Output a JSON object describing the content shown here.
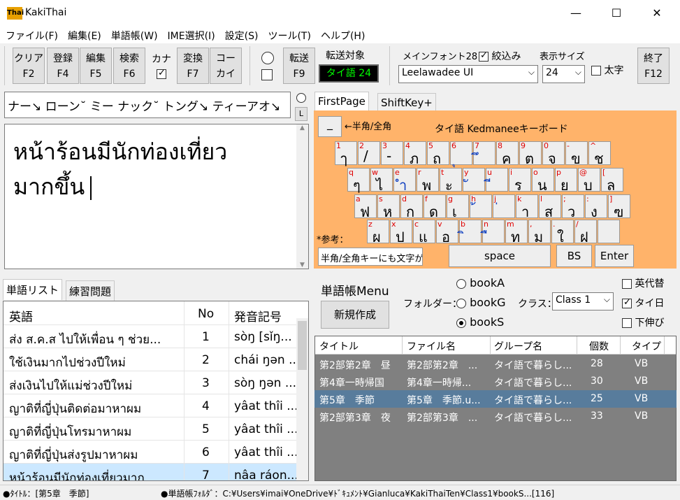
{
  "app": {
    "title": "KakiThai",
    "logo": "Thai"
  },
  "window": {
    "minimize": "—",
    "maximize": "☐",
    "close": "✕"
  },
  "menu": [
    "ファイル(F)",
    "編集(E)",
    "単語帳(W)",
    "IME選択(I)",
    "設定(S)",
    "ツール(T)",
    "ヘルプ(H)"
  ],
  "toolbar": {
    "clear": [
      "クリア",
      "F2"
    ],
    "register": [
      "登録",
      "F4"
    ],
    "edit": [
      "編集",
      "F5"
    ],
    "search": [
      "検索",
      "F6"
    ],
    "kana_label": "カナ",
    "convert": [
      "変換",
      "F7"
    ],
    "copy": [
      "コー",
      "カイ"
    ],
    "transfer": [
      "転送",
      "F9"
    ],
    "target_label": "転送対象",
    "target_value": "タイ語 24",
    "main_font_label": "メインフォント28",
    "filter_label": "絞込み",
    "font_value": "Leelawadee UI",
    "display_size_label": "表示サイズ",
    "size_value": "24",
    "bold_label": "太字",
    "exit": [
      "終了",
      "F12"
    ]
  },
  "reading": {
    "text": "ナー↘ ローン˘ ミー ナック˘ トング↘ ティーアオ↘",
    "side_button": "L"
  },
  "editor": {
    "line1": "หน้าร้อนมีนักท่องเที่ยว",
    "line2": "มากขึ้น"
  },
  "left_tabs": [
    "単語リスト",
    "練習問題"
  ],
  "word_table": {
    "headers": [
      "英語",
      "No",
      "発音記号"
    ],
    "rows": [
      [
        "ส่ง ส.ค.ส ไปให้เพื่อน ๆ ช่วย...",
        "1",
        "sòŋ [sǐŋ..."
      ],
      [
        "ใช้เงินมากไปช่วงปีใหม่",
        "2",
        "chái ŋən ..."
      ],
      [
        "ส่งเงินไปให้แม่ช่วงปีใหม่",
        "3",
        "sòŋ ŋən ..."
      ],
      [
        "ญาติที่ญี่ปุ่นติดต่อมาหาผม",
        "4",
        "yâat thîi ..."
      ],
      [
        "ญาติที่ญี่ปุ่นโทรมาหาผม",
        "5",
        "yâat thîi ..."
      ],
      [
        "ญาติที่ญี่ปุ่นส่งรูปมาหาผม",
        "6",
        "yâat thîi ..."
      ],
      [
        "หน้าร้อนมีนักท่องเที่ยวมาก",
        "7",
        "nâa ráon..."
      ]
    ]
  },
  "kb_tabs": [
    "FirstPage",
    "ShiftKey+"
  ],
  "keyboard": {
    "zen_key": "_",
    "zen_label": "←半角/全角",
    "title": "タイ語 Kedmaneeキーボード",
    "note": "*参考：",
    "note_box": "半角/全角キーにも文字が",
    "space": "space",
    "bs": "BS",
    "enter": "Enter",
    "rows": [
      [
        [
          "1",
          "ๅ"
        ],
        [
          "2",
          "/"
        ],
        [
          "3",
          "-"
        ],
        [
          "4",
          "ภ"
        ],
        [
          "5",
          "ถ"
        ],
        [
          "6",
          "ุ"
        ],
        [
          "7",
          "ึ"
        ],
        [
          "8",
          "ค"
        ],
        [
          "9",
          "ต"
        ],
        [
          "0",
          "จ"
        ],
        [
          "-",
          "ข"
        ],
        [
          "^",
          "ช"
        ]
      ],
      [
        [
          "q",
          "ๆ"
        ],
        [
          "w",
          "ไ"
        ],
        [
          "e",
          "ำ"
        ],
        [
          "r",
          "พ"
        ],
        [
          "t",
          "ะ"
        ],
        [
          "y",
          "ั"
        ],
        [
          "u",
          "ี"
        ],
        [
          "i",
          "ร"
        ],
        [
          "o",
          "น"
        ],
        [
          "p",
          "ย"
        ],
        [
          "@",
          "บ"
        ],
        [
          "[",
          "ล"
        ]
      ],
      [
        [
          "a",
          "ฟ"
        ],
        [
          "s",
          "ห"
        ],
        [
          "d",
          "ก"
        ],
        [
          "f",
          "ด"
        ],
        [
          "g",
          "เ"
        ],
        [
          "h",
          "้"
        ],
        [
          "j",
          "่"
        ],
        [
          "k",
          "า"
        ],
        [
          "l",
          "ส"
        ],
        [
          ";",
          "ว"
        ],
        [
          ":",
          "ง"
        ],
        [
          "]",
          "ฃ"
        ]
      ],
      [
        [
          "z",
          "ผ"
        ],
        [
          "x",
          "ป"
        ],
        [
          "c",
          "แ"
        ],
        [
          "v",
          "อ"
        ],
        [
          "b",
          "ิ"
        ],
        [
          "n",
          "ื"
        ],
        [
          "m",
          "ท"
        ],
        [
          ",",
          "ม"
        ],
        [
          ".",
          "ใ"
        ],
        [
          "/",
          "ฝ"
        ],
        [
          "",
          ""
        ]
      ]
    ]
  },
  "vocab": {
    "menu_label": "単語帳Menu",
    "new_button": "新規作成",
    "folder_label": "フォルダー：",
    "class_label": "クラス：",
    "folders": [
      "bookA",
      "bookG",
      "bookS"
    ],
    "class_value": "Class 1",
    "opt_eiyo": "英代替",
    "opt_thai": "タイ日",
    "opt_shita": "下伸び",
    "headers": [
      "タイトル",
      "ファイル名",
      "グループ名",
      "個数",
      "タイプ"
    ],
    "rows": [
      [
        "第2部第2章　昼",
        "第2部第2章　...",
        "タイ語で暮らし...",
        "28",
        "VB"
      ],
      [
        "第4章一時帰国",
        "第4章一時帰...",
        "タイ語で暮らし...",
        "30",
        "VB"
      ],
      [
        "第5章　季節",
        "第5章　季節.u...",
        "タイ語で暮らし...",
        "25",
        "VB"
      ],
      [
        "第2部第3章　夜",
        "第2部第3章　...",
        "タイ語で暮らし...",
        "33",
        "VB"
      ]
    ]
  },
  "status": {
    "left": "●ﾀｲﾄﾙ：[第5章　季節]",
    "right": "●単語帳ﾌｫﾙﾀﾞ：C:¥Users¥imai¥OneDrive¥ﾄﾞｷｭﾒﾝﾄ¥Gianluca¥KakiThaiTen¥Class1¥bookS...[116]"
  },
  "colors": {
    "keyboard_bg": "#ffb36a",
    "target_bg": "#000000",
    "target_fg": "#00ff00",
    "dark_grid": "#808080",
    "selected_row": "#587c9c"
  }
}
